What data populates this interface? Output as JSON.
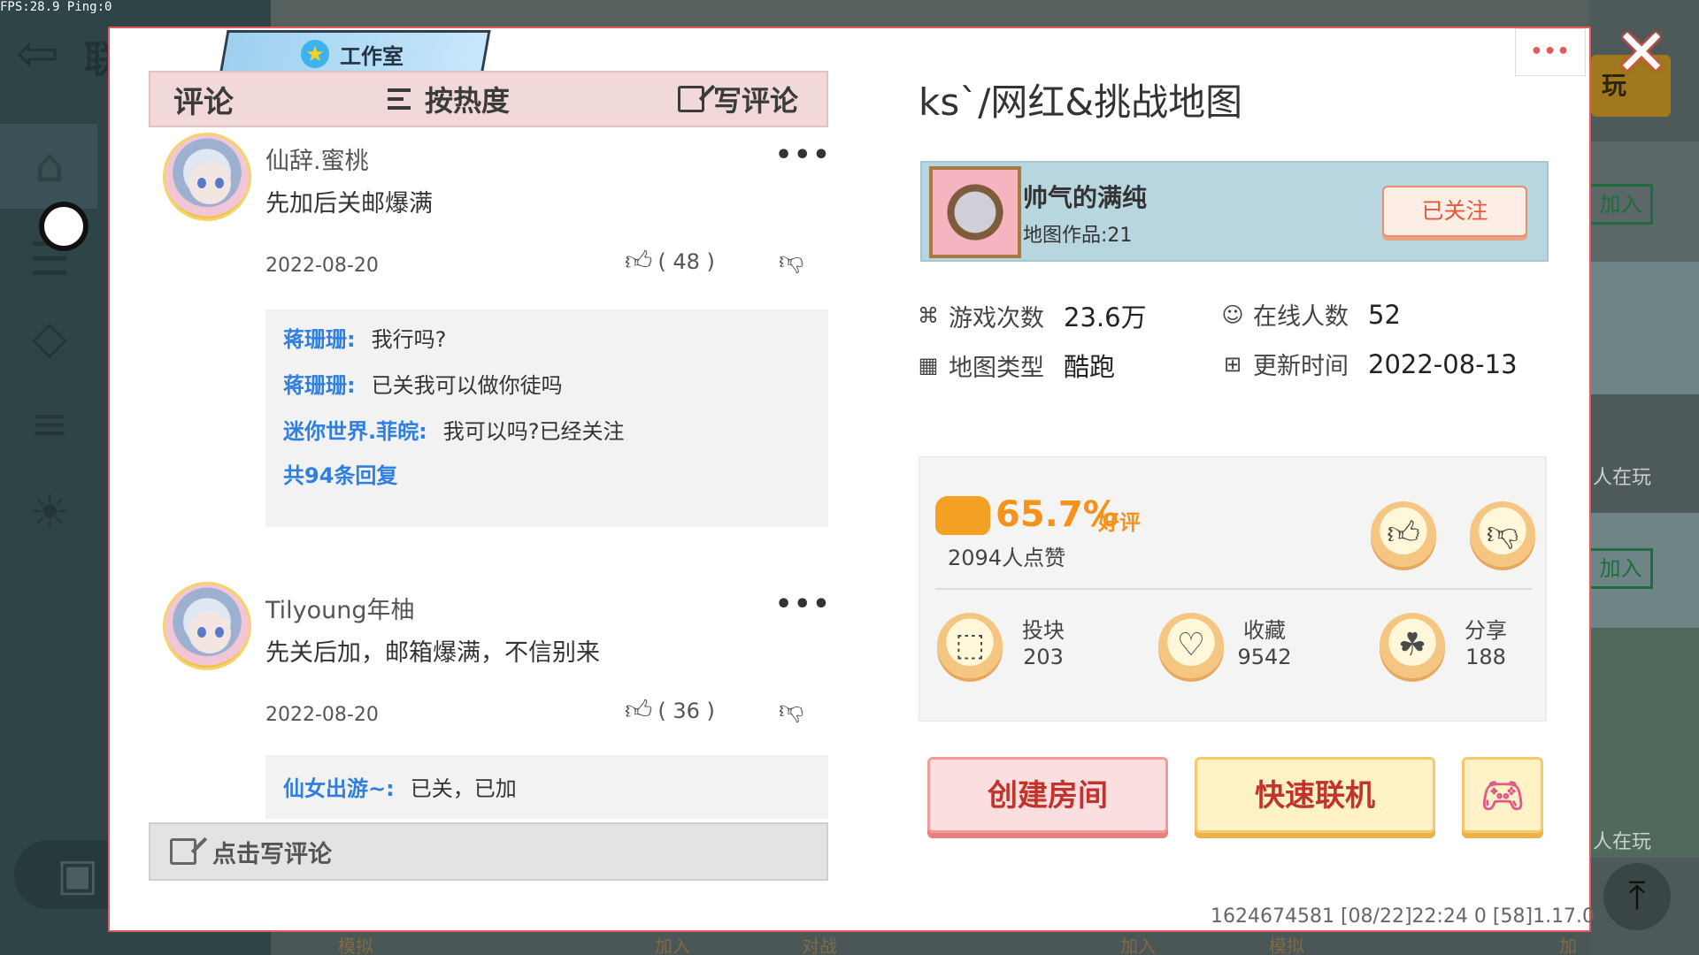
{
  "hud": {
    "fps": "FPS:28.9  Ping:0"
  },
  "background": {
    "title_fragment": "联",
    "play_label": "玩",
    "join_label": "加入",
    "playing_label": "人在玩",
    "bottom_labels": [
      "模拟",
      "加入",
      "对战",
      "加入",
      "模拟",
      "加入"
    ]
  },
  "studio": {
    "label": "工作室"
  },
  "comment_header": {
    "title": "评论",
    "sort_label": "按热度",
    "write_label": "写评论"
  },
  "comments": [
    {
      "name": "仙辞.蜜桃",
      "text": "先加后关邮爆满",
      "date": "2022-08-20",
      "likes": "( 48 )",
      "more": "•••",
      "replies": [
        {
          "name": "蒋珊珊:",
          "text": "我行吗?"
        },
        {
          "name": "蒋珊珊:",
          "text": "已关我可以做你徒吗"
        },
        {
          "name": "迷你世界.菲皖:",
          "text": "我可以吗?已经关注"
        }
      ],
      "reply_total": "共94条回复"
    },
    {
      "name": "Tilyoung年柚",
      "text": "先关后加，邮箱爆满，不信别来",
      "date": "2022-08-20",
      "likes": "( 36 )",
      "more": "•••",
      "replies": [
        {
          "name": "仙女出游~:",
          "text": "已关，已加"
        }
      ]
    }
  ],
  "write_bar": {
    "label": "点击写评论"
  },
  "map": {
    "title": "ks`/网红&挑战地图",
    "more_label": "•••",
    "author": {
      "name": "帅气的满纯",
      "works": "地图作品:21",
      "follow_label": "已关注"
    },
    "stats": {
      "plays_label": "游戏次数",
      "plays_value": "23.6万",
      "online_label": "在线人数",
      "online_value": "52",
      "type_label": "地图类型",
      "type_value": "酷跑",
      "updated_label": "更新时间",
      "updated_value": "2022-08-13"
    },
    "rating": {
      "percent": "65.7%",
      "good_label": "好评",
      "likes_text": "2094人点赞",
      "actions": [
        {
          "label": "投块",
          "value": "203",
          "icon": "block-icon"
        },
        {
          "label": "收藏",
          "value": "9542",
          "icon": "heart-icon"
        },
        {
          "label": "分享",
          "value": "188",
          "icon": "share-icon"
        }
      ]
    },
    "buttons": {
      "create_room": "创建房间",
      "quick_join": "快速联机"
    }
  },
  "footer": {
    "version": "1624674581   [08/22]22:24 0  [58]1.17.0"
  },
  "colors": {
    "accent": "#e25a5a",
    "link": "#2f7fe0",
    "rating": "#f4921a"
  }
}
